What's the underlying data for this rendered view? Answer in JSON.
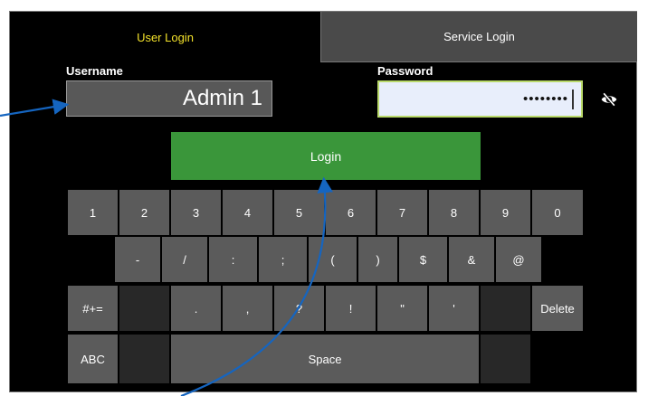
{
  "tabs": {
    "user": "User Login",
    "service": "Service Login"
  },
  "form": {
    "username_label": "Username",
    "username_value": "Admin 1",
    "password_label": "Password",
    "password_value": "••••••••"
  },
  "login_label": "Login",
  "keyboard": {
    "row1": [
      "1",
      "2",
      "3",
      "4",
      "5",
      "6",
      "7",
      "8",
      "9",
      "0"
    ],
    "row2": [
      "-",
      "/",
      ":",
      ";",
      "(",
      ")",
      "$",
      "&",
      "@"
    ],
    "row3": [
      "#+=",
      "",
      ".",
      ",",
      "?",
      "!",
      "\"",
      "'",
      "",
      "Delete"
    ],
    "row4": [
      "ABC",
      "",
      "Space",
      ""
    ]
  },
  "icons": {
    "password_visibility": "eye-off-icon"
  },
  "colors": {
    "active_tab_text": "#f2e12a",
    "login_button": "#3a963a",
    "password_border": "#b9d96a",
    "annotation_arrow": "#1565c0"
  }
}
